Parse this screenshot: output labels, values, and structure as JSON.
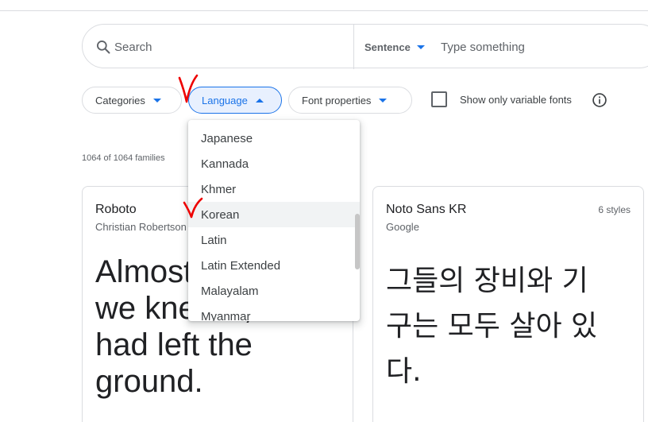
{
  "search": {
    "placeholder": "Search",
    "preview_mode": "Sentence",
    "preview_placeholder": "Type something"
  },
  "filters": {
    "categories_label": "Categories",
    "language_label": "Language",
    "font_properties_label": "Font properties",
    "variable_fonts_label": "Show only variable fonts"
  },
  "family_count": "1064 of 1064 families",
  "language_menu": {
    "items": [
      {
        "label": "Japanese"
      },
      {
        "label": "Kannada"
      },
      {
        "label": "Khmer"
      },
      {
        "label": "Korean"
      },
      {
        "label": "Latin"
      },
      {
        "label": "Latin Extended"
      },
      {
        "label": "Malayalam"
      },
      {
        "label": "Myanmar"
      }
    ],
    "hovered_item": "Korean"
  },
  "cards": [
    {
      "name": "Roboto",
      "author": "Christian Robertson",
      "styles": "",
      "sample_lines": [
        "Almost before",
        "we knew it, we",
        "had left the",
        "ground."
      ]
    },
    {
      "name": "Noto Sans KR",
      "author": "Google",
      "styles": "6 styles",
      "sample_lines": [
        "그들의 장비와 기",
        "구는 모두 살아 있",
        "다."
      ]
    }
  ],
  "colors": {
    "accent": "#1a73e8",
    "chip_active_bg": "#e8f0fe",
    "border": "#dadce0",
    "annotation": "#ee0000"
  },
  "icons": {
    "search": "search-icon",
    "caret": "caret-down-icon",
    "info": "info-icon"
  }
}
